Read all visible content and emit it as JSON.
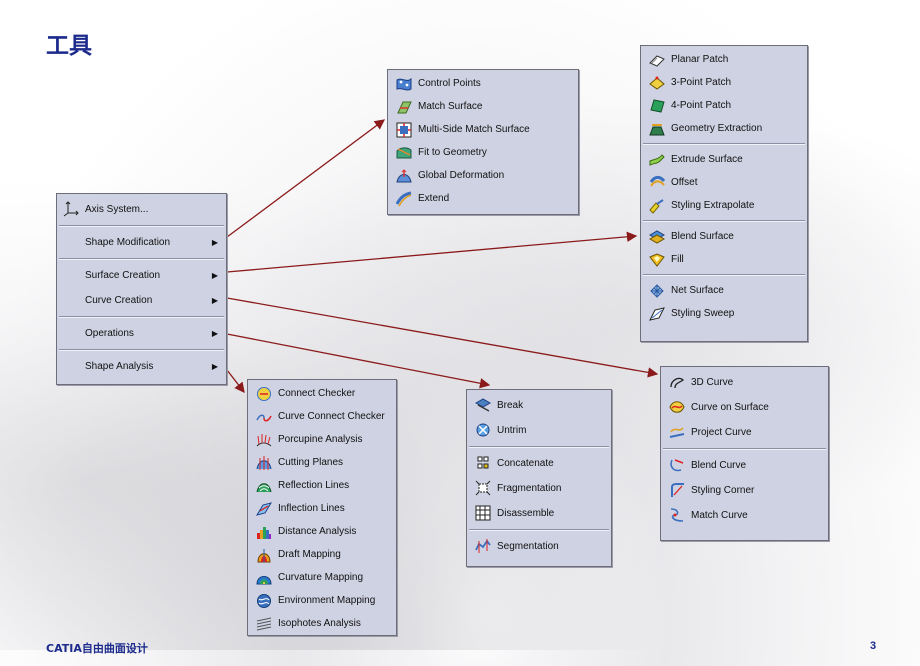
{
  "title": "工具",
  "footer": "CATIA自由曲面设计",
  "page_number": "3",
  "main_menu": {
    "items": [
      {
        "label": "Axis System...",
        "icon": "axis-system-icon"
      },
      {
        "label": "Shape Modification",
        "arrow": "▶"
      },
      {
        "label": "Surface Creation",
        "arrow": "▶"
      },
      {
        "label": "Curve Creation",
        "arrow": "▶"
      },
      {
        "label": "Operations",
        "arrow": "▶"
      },
      {
        "label": "Shape Analysis",
        "arrow": "▶"
      }
    ]
  },
  "shape_modification": {
    "items": [
      {
        "label": "Control Points"
      },
      {
        "label": "Match Surface"
      },
      {
        "label": "Multi-Side Match Surface"
      },
      {
        "label": "Fit to Geometry"
      },
      {
        "label": "Global Deformation"
      },
      {
        "label": "Extend"
      }
    ]
  },
  "surface_creation": {
    "items": [
      {
        "label": "Planar Patch"
      },
      {
        "label": "3-Point Patch"
      },
      {
        "label": "4-Point Patch"
      },
      {
        "label": "Geometry Extraction"
      },
      {
        "label": "Extrude Surface"
      },
      {
        "label": "Offset"
      },
      {
        "label": "Styling Extrapolate"
      },
      {
        "label": "Blend Surface"
      },
      {
        "label": "Fill"
      },
      {
        "label": "Net Surface"
      },
      {
        "label": "Styling Sweep"
      }
    ]
  },
  "curve_creation": {
    "items": [
      {
        "label": "3D Curve"
      },
      {
        "label": "Curve on Surface"
      },
      {
        "label": "Project Curve"
      },
      {
        "label": "Blend Curve"
      },
      {
        "label": "Styling Corner"
      },
      {
        "label": "Match Curve"
      }
    ]
  },
  "operations": {
    "items": [
      {
        "label": "Break"
      },
      {
        "label": "Untrim"
      },
      {
        "label": "Concatenate"
      },
      {
        "label": "Fragmentation"
      },
      {
        "label": "Disassemble"
      },
      {
        "label": "Segmentation"
      }
    ]
  },
  "shape_analysis": {
    "items": [
      {
        "label": "Connect Checker"
      },
      {
        "label": "Curve Connect Checker"
      },
      {
        "label": "Porcupine Analysis"
      },
      {
        "label": "Cutting Planes"
      },
      {
        "label": "Reflection Lines"
      },
      {
        "label": "Inflection Lines"
      },
      {
        "label": "Distance Analysis"
      },
      {
        "label": "Draft Mapping"
      },
      {
        "label": "Curvature Mapping"
      },
      {
        "label": "Environment Mapping"
      },
      {
        "label": "Isophotes Analysis"
      }
    ]
  },
  "colors": {
    "title": "#1c2a8c",
    "menu_bg": "#cfd2e2",
    "connector": "#8b1a1a"
  }
}
